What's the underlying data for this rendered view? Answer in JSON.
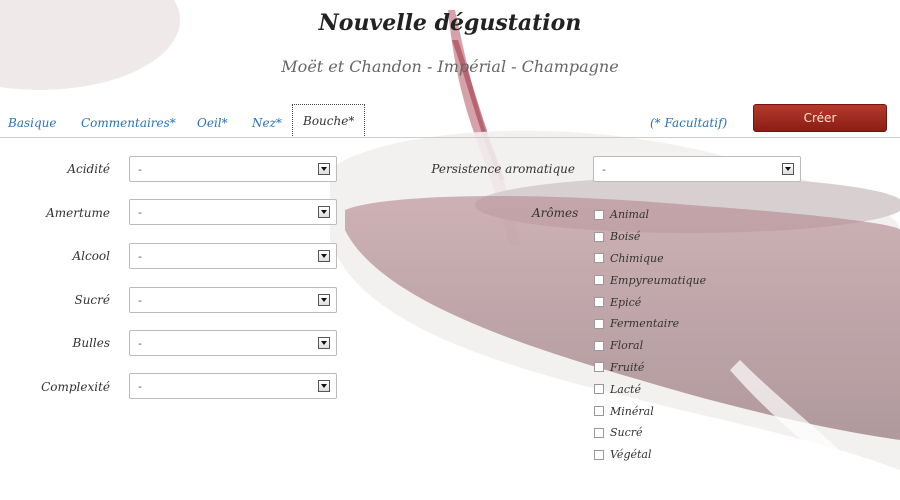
{
  "header": {
    "title": "Nouvelle dégustation",
    "subtitle": "Moët et Chandon - Impérial - Champagne"
  },
  "tabs": [
    {
      "label": "Basique",
      "active": false
    },
    {
      "label": "Commentaires*",
      "active": false
    },
    {
      "label": "Oeil*",
      "active": false
    },
    {
      "label": "Nez*",
      "active": false
    },
    {
      "label": "Bouche*",
      "active": true
    }
  ],
  "toolbar": {
    "optional_note": "(* Facultatif)",
    "create_label": "Créer",
    "create_color": "#a12d22"
  },
  "fields_left": [
    {
      "label": "Acidité",
      "value": "-"
    },
    {
      "label": "Amertume",
      "value": "-"
    },
    {
      "label": "Alcool",
      "value": "-"
    },
    {
      "label": "Sucré",
      "value": "-"
    },
    {
      "label": "Bulles",
      "value": "-"
    },
    {
      "label": "Complexité",
      "value": "-"
    }
  ],
  "persistence": {
    "label": "Persistence aromatique",
    "value": "-"
  },
  "aromes": {
    "label": "Arômes",
    "items": [
      {
        "label": "Animal",
        "checked": false
      },
      {
        "label": "Boisé",
        "checked": false
      },
      {
        "label": "Chimique",
        "checked": false
      },
      {
        "label": "Empyreumatique",
        "checked": false
      },
      {
        "label": "Epicé",
        "checked": false
      },
      {
        "label": "Fermentaire",
        "checked": false
      },
      {
        "label": "Floral",
        "checked": false
      },
      {
        "label": "Fruité",
        "checked": false
      },
      {
        "label": "Lacté",
        "checked": false
      },
      {
        "label": "Minéral",
        "checked": false
      },
      {
        "label": "Sucré",
        "checked": false
      },
      {
        "label": "Végétal",
        "checked": false
      }
    ]
  }
}
